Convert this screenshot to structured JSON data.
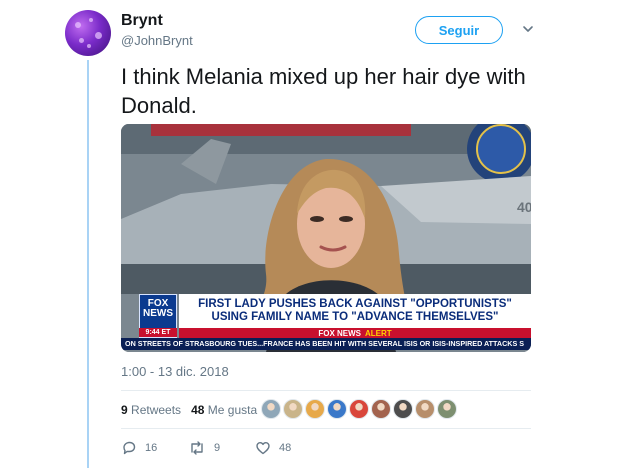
{
  "author": {
    "name": "Brynt",
    "handle": "@JohnBrynt"
  },
  "follow_label": "Seguir",
  "tweet": {
    "text": "I think Melania mixed up her hair dye with Donald."
  },
  "media": {
    "fox_logo_line1": "FOX",
    "fox_logo_line2": "NEWS",
    "fox_time": "9:44 ET",
    "headline_line1": "FIRST LADY PUSHES BACK AGAINST \"OPPORTUNISTS\"",
    "headline_line2": "USING FAMILY NAME TO \"ADVANCE THEMSELVES\"",
    "alert_brand": "FOX NEWS",
    "alert_word": "ALERT",
    "ticker": "ON STREETS OF STRASBOURG TUES...FRANCE HAS BEEN HIT WITH SEVERAL ISIS OR ISIS-INSPIRED ATTACKS S",
    "jet_number": "40"
  },
  "timestamp": "1:00 - 13 dic. 2018",
  "stats": {
    "retweets_count": "9",
    "retweets_label": "Retweets",
    "likes_count": "48",
    "likes_label": "Me gusta"
  },
  "likers": [
    {
      "icon": "avatar-1",
      "color": "#8fa7b8"
    },
    {
      "icon": "avatar-2",
      "color": "#c9b48a"
    },
    {
      "icon": "avatar-3",
      "color": "#e7a94a"
    },
    {
      "icon": "avatar-4",
      "color": "#3a78c9"
    },
    {
      "icon": "avatar-5",
      "color": "#d9463b"
    },
    {
      "icon": "avatar-6",
      "color": "#a3634e"
    },
    {
      "icon": "avatar-7",
      "color": "#4d4d4d"
    },
    {
      "icon": "avatar-8",
      "color": "#b78e6b"
    },
    {
      "icon": "avatar-9",
      "color": "#7d8f70"
    }
  ],
  "actions": {
    "replies": "16",
    "retweets": "9",
    "likes": "48"
  },
  "colors": {
    "accent": "#1da1f2",
    "thread_line": "#a9d3f5",
    "fox_blue": "#0a2c7a",
    "fox_red": "#c8102e"
  }
}
